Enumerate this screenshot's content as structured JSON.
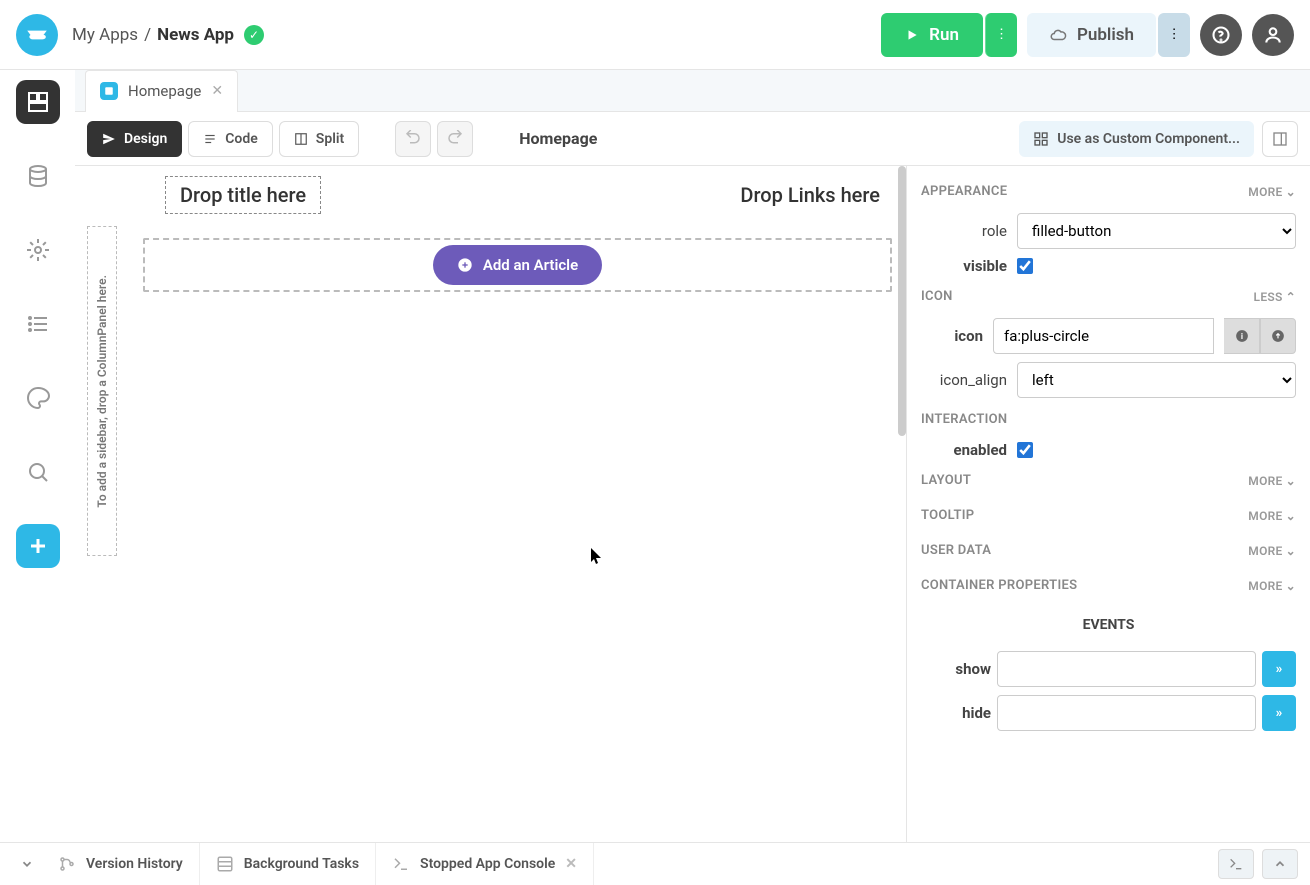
{
  "header": {
    "breadcrumb_root": "My Apps",
    "breadcrumb_current": "News App",
    "run_label": "Run",
    "publish_label": "Publish"
  },
  "tabs": {
    "homepage": "Homepage"
  },
  "toolbar": {
    "design": "Design",
    "code": "Code",
    "split": "Split",
    "page_name": "Homepage",
    "custom_component": "Use as Custom Component..."
  },
  "canvas": {
    "sidebar_hint": "To add a sidebar, drop a ColumnPanel here.",
    "title_placeholder": "Drop title here",
    "links_placeholder": "Drop Links here",
    "add_article": "Add an Article"
  },
  "props": {
    "appearance": {
      "title": "APPEARANCE",
      "more": "MORE",
      "role_label": "role",
      "role_value": "filled-button",
      "visible_label": "visible"
    },
    "icon_section": {
      "title": "ICON",
      "less": "LESS",
      "icon_label": "icon",
      "icon_value": "fa:plus-circle",
      "icon_align_label": "icon_align",
      "icon_align_value": "left"
    },
    "interaction": {
      "title": "INTERACTION",
      "enabled_label": "enabled"
    },
    "layout": {
      "title": "LAYOUT",
      "more": "MORE"
    },
    "tooltip": {
      "title": "TOOLTIP",
      "more": "MORE"
    },
    "userdata": {
      "title": "USER DATA",
      "more": "MORE"
    },
    "container": {
      "title": "CONTAINER PROPERTIES",
      "more": "MORE"
    },
    "events": {
      "title": "EVENTS",
      "show": "show",
      "hide": "hide",
      "arrow": "»"
    }
  },
  "footer": {
    "version_history": "Version History",
    "background_tasks": "Background Tasks",
    "stopped_console": "Stopped App Console"
  }
}
